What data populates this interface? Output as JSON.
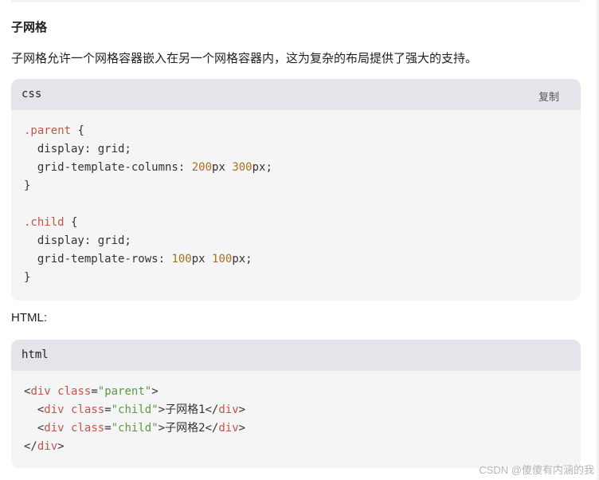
{
  "section": {
    "heading": "子网格",
    "description": "子网格允许一个网格容器嵌入在另一个网格容器内，这为复杂的布局提供了强大的支持。"
  },
  "css_block": {
    "language": "css",
    "copy_label": "复制",
    "lines": [
      [
        {
          "t": "sel",
          "v": ".parent"
        },
        {
          "t": "plain",
          "v": " {"
        }
      ],
      [
        {
          "t": "plain",
          "v": "  display: grid;"
        }
      ],
      [
        {
          "t": "plain",
          "v": "  grid-template-columns: "
        },
        {
          "t": "num",
          "v": "200"
        },
        {
          "t": "plain",
          "v": "px "
        },
        {
          "t": "num",
          "v": "300"
        },
        {
          "t": "plain",
          "v": "px;"
        }
      ],
      [
        {
          "t": "plain",
          "v": "}"
        }
      ],
      [],
      [
        {
          "t": "sel",
          "v": ".child"
        },
        {
          "t": "plain",
          "v": " {"
        }
      ],
      [
        {
          "t": "plain",
          "v": "  display: grid;"
        }
      ],
      [
        {
          "t": "plain",
          "v": "  grid-template-rows: "
        },
        {
          "t": "num",
          "v": "100"
        },
        {
          "t": "plain",
          "v": "px "
        },
        {
          "t": "num",
          "v": "100"
        },
        {
          "t": "plain",
          "v": "px;"
        }
      ],
      [
        {
          "t": "plain",
          "v": "}"
        }
      ]
    ]
  },
  "html_label": "HTML:",
  "html_block": {
    "language": "html",
    "lines": [
      [
        {
          "t": "plain",
          "v": "<"
        },
        {
          "t": "tag",
          "v": "div"
        },
        {
          "t": "plain",
          "v": " "
        },
        {
          "t": "attr",
          "v": "class"
        },
        {
          "t": "plain",
          "v": "="
        },
        {
          "t": "str",
          "v": "\"parent\""
        },
        {
          "t": "plain",
          "v": ">"
        }
      ],
      [
        {
          "t": "plain",
          "v": "  <"
        },
        {
          "t": "tag",
          "v": "div"
        },
        {
          "t": "plain",
          "v": " "
        },
        {
          "t": "attr",
          "v": "class"
        },
        {
          "t": "plain",
          "v": "="
        },
        {
          "t": "str",
          "v": "\"child\""
        },
        {
          "t": "plain",
          "v": ">子网格1</"
        },
        {
          "t": "tag",
          "v": "div"
        },
        {
          "t": "plain",
          "v": ">"
        }
      ],
      [
        {
          "t": "plain",
          "v": "  <"
        },
        {
          "t": "tag",
          "v": "div"
        },
        {
          "t": "plain",
          "v": " "
        },
        {
          "t": "attr",
          "v": "class"
        },
        {
          "t": "plain",
          "v": "="
        },
        {
          "t": "str",
          "v": "\"child\""
        },
        {
          "t": "plain",
          "v": ">子网格2</"
        },
        {
          "t": "tag",
          "v": "div"
        },
        {
          "t": "plain",
          "v": ">"
        }
      ],
      [
        {
          "t": "plain",
          "v": "</"
        },
        {
          "t": "tag",
          "v": "div"
        },
        {
          "t": "plain",
          "v": ">"
        }
      ]
    ]
  },
  "watermark": "CSDN @傻傻有内涵的我",
  "colors": {
    "header_bg": "#e4e5ea",
    "code_bg": "#f5f5f6",
    "selector": "#c0564a",
    "number": "#a9701c",
    "string": "#5a9a40"
  }
}
